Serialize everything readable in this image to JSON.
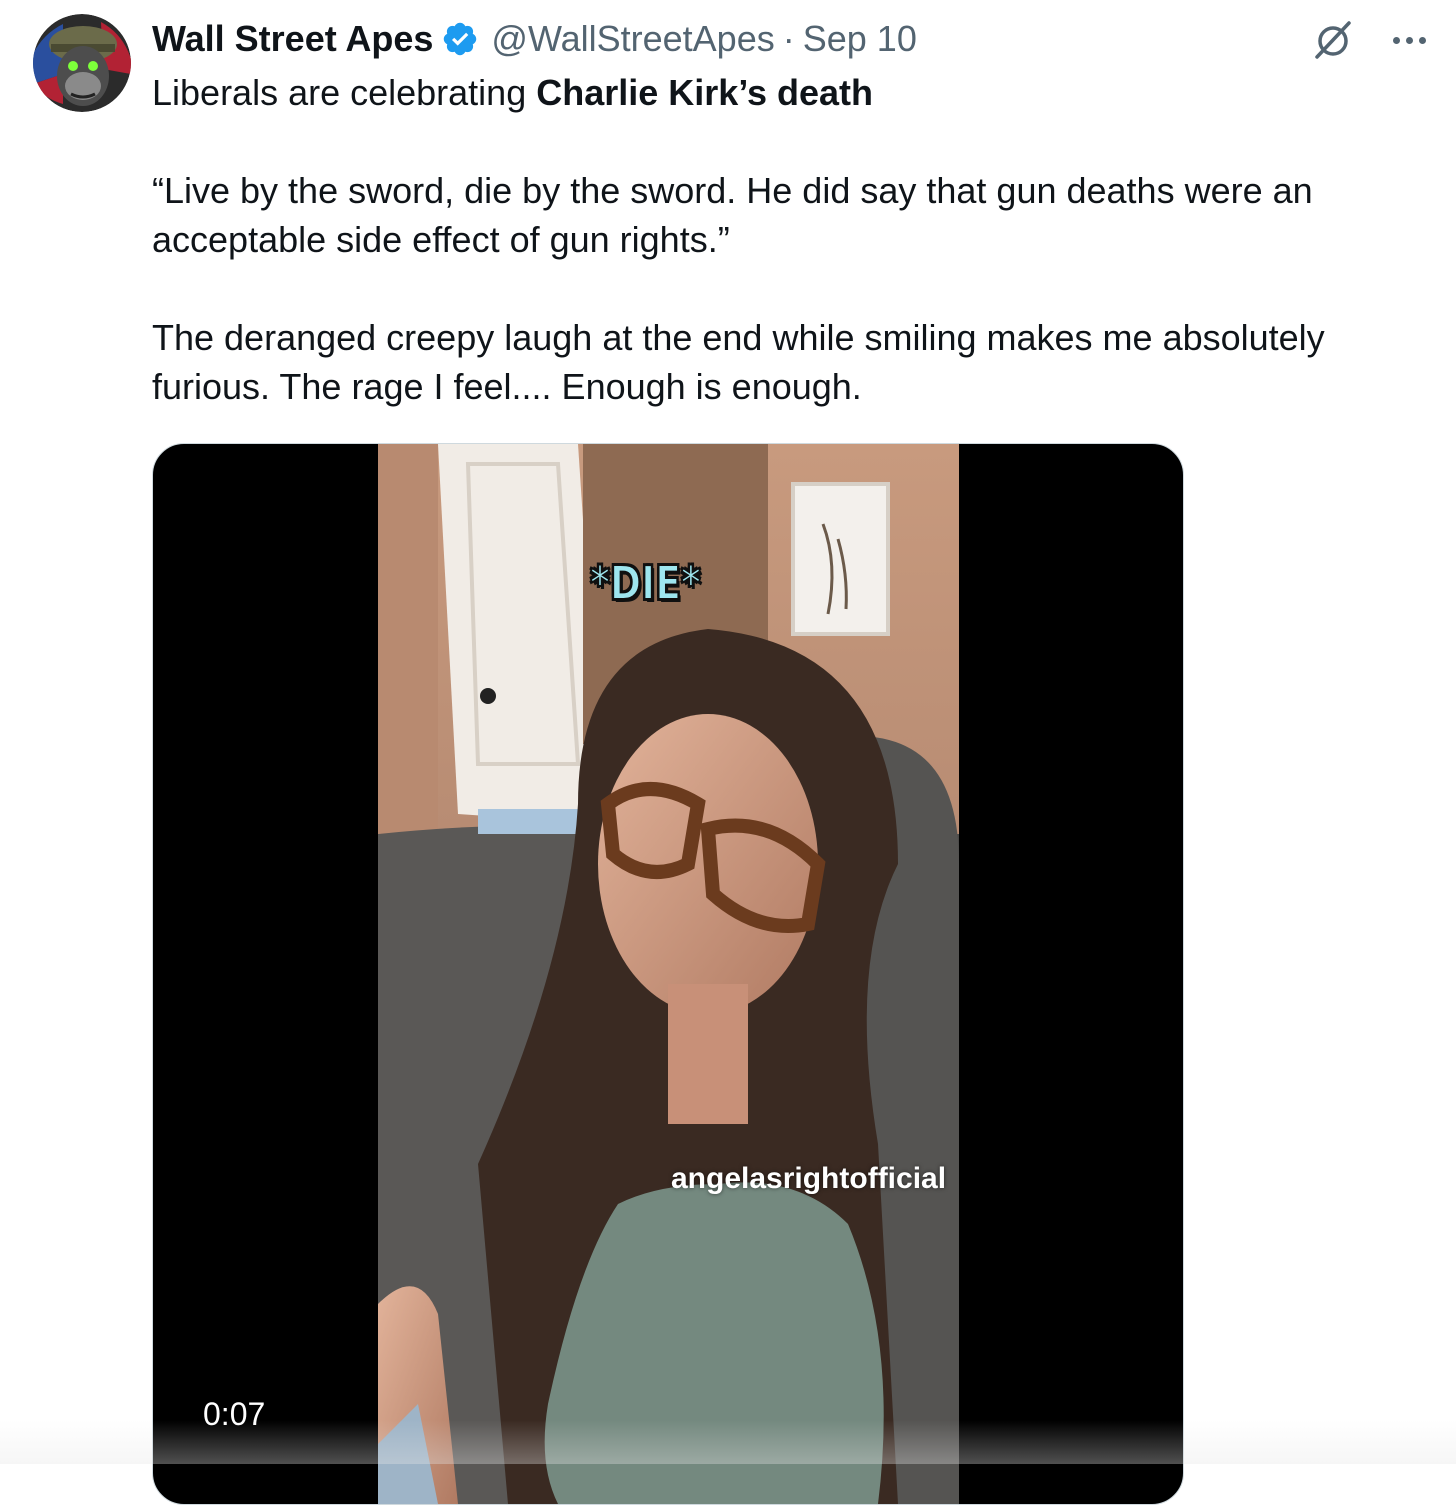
{
  "tweet": {
    "author": {
      "display_name": "Wall Street Apes",
      "handle": "@WallStreetApes",
      "verified": true,
      "avatar_icon": "gorilla-soldier-avatar"
    },
    "separator": "·",
    "date": "Sep 10",
    "text": {
      "line1_prefix": "Liberals are celebrating ",
      "line1_bold": "Charlie Kirk’s death",
      "paragraph2": "“Live by the sword, die by the sword. He did say that gun deaths were an acceptable side effect of gun rights.”",
      "paragraph3": "The deranged creepy laugh at the end while smiling makes me absolutely furious. The rage I feel.... Enough is enough."
    },
    "actions": {
      "grok_icon": "grok-icon",
      "more_icon": "more-dots-icon"
    },
    "media": {
      "type": "video",
      "duration": "0:07",
      "caption_overlay": "*DIE*",
      "watermark": "angelasrightofficial"
    }
  },
  "colors": {
    "text_primary": "#0f1419",
    "text_secondary": "#536471",
    "verified_blue": "#1d9bf0",
    "media_border": "#cfd9de",
    "caption_cyan": "#9ee6ef"
  }
}
